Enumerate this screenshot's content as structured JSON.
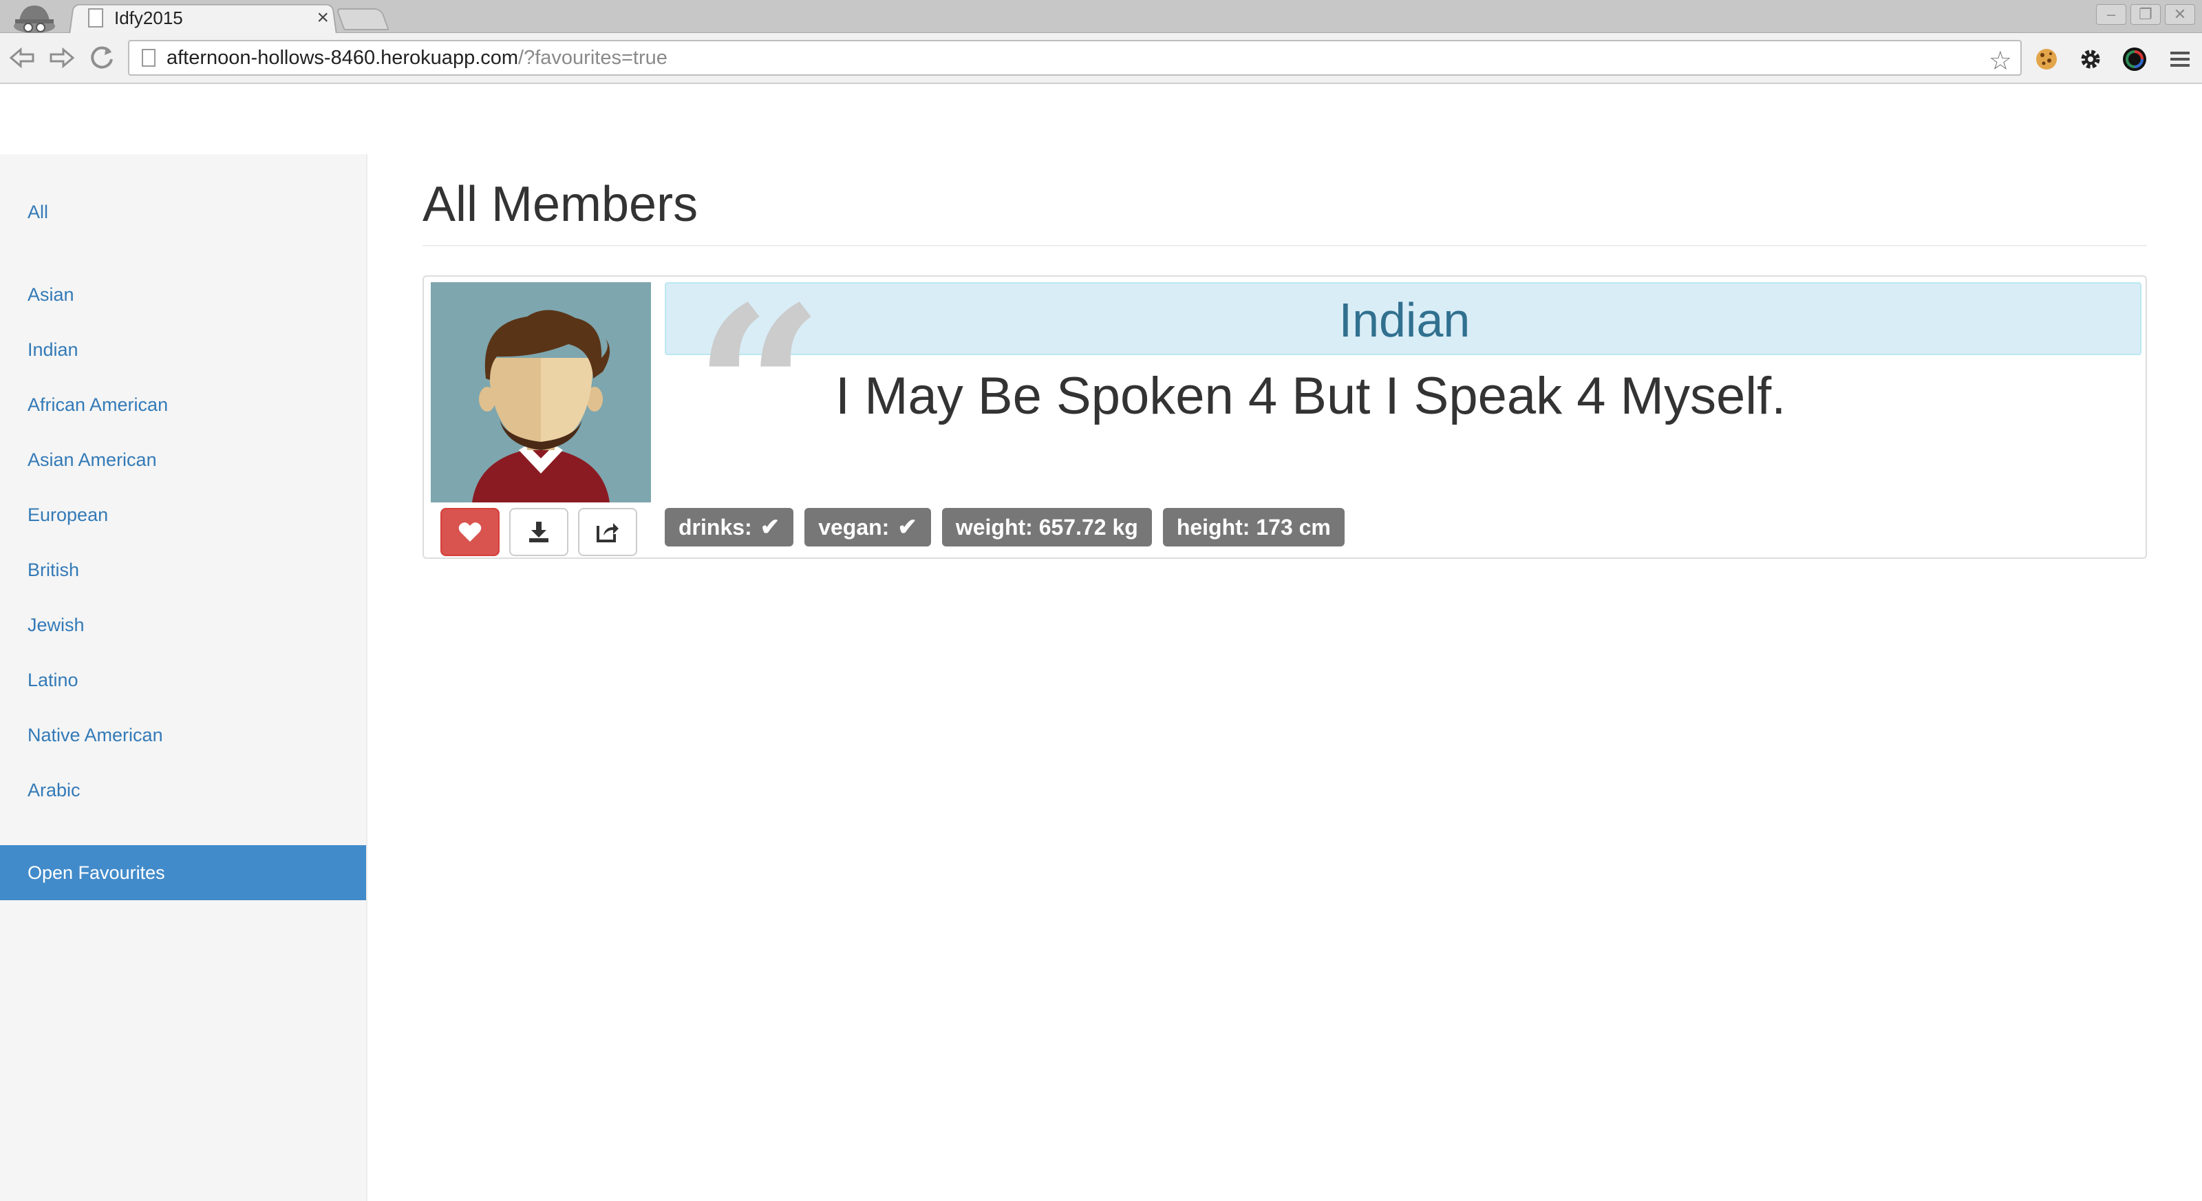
{
  "browser": {
    "tab_title": "Idfy2015",
    "tab_close": "×",
    "url_host": "afternoon-hollows-8460.herokuapp.com",
    "url_rest": "/?favourites=true",
    "back_icon": "back-arrow-icon",
    "forward_icon": "forward-arrow-icon",
    "reload_icon": "reload-icon",
    "window_controls": [
      "–",
      "❐",
      "✕"
    ]
  },
  "sidebar": {
    "items": [
      {
        "label": "All"
      },
      {
        "label": "Asian"
      },
      {
        "label": "Indian"
      },
      {
        "label": "African American"
      },
      {
        "label": "Asian American"
      },
      {
        "label": "European"
      },
      {
        "label": "British"
      },
      {
        "label": "Jewish"
      },
      {
        "label": "Latino"
      },
      {
        "label": "Native American"
      },
      {
        "label": "Arabic"
      }
    ],
    "favourites": {
      "label": "Open Favourites"
    }
  },
  "main": {
    "title": "All Members",
    "card": {
      "heading": "Indian",
      "quote": "I May Be Spoken 4 But I Speak 4 Myself.",
      "quote_mark": "“",
      "tags": [
        {
          "label": "drinks:",
          "check": "✔"
        },
        {
          "label": "vegan:",
          "check": "✔"
        },
        {
          "label": "weight: 657.72 kg"
        },
        {
          "label": "height: 173 cm"
        }
      ],
      "buttons": {
        "favourite_icon": "heart-icon",
        "download_icon": "download-icon",
        "share_icon": "share-icon"
      }
    }
  },
  "colors": {
    "link": "#337ab7",
    "active_bg": "#428bca",
    "favourite_bg": "#d9534f",
    "heading_bg": "#d9edf7",
    "heading_text": "#31708f",
    "tag_bg": "#777777"
  }
}
